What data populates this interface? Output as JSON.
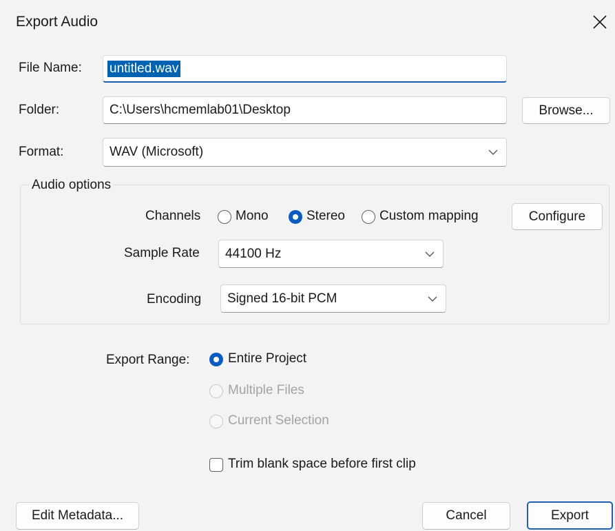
{
  "window": {
    "title": "Export Audio"
  },
  "file_name": {
    "label": "File Name:",
    "value": "untitled.wav"
  },
  "folder": {
    "label": "Folder:",
    "value": "C:\\Users\\hcmemlab01\\Desktop",
    "browse_label": "Browse..."
  },
  "format": {
    "label": "Format:",
    "selected": "WAV (Microsoft)"
  },
  "audio_options": {
    "legend": "Audio options",
    "channels": {
      "label": "Channels",
      "options": [
        {
          "label": "Mono",
          "checked": false
        },
        {
          "label": "Stereo",
          "checked": true
        },
        {
          "label": "Custom mapping",
          "checked": false
        }
      ],
      "configure_label": "Configure"
    },
    "sample_rate": {
      "label": "Sample Rate",
      "selected": "44100 Hz"
    },
    "encoding": {
      "label": "Encoding",
      "selected": "Signed 16-bit PCM"
    }
  },
  "export_range": {
    "label": "Export Range:",
    "options": [
      {
        "label": "Entire Project",
        "checked": true,
        "enabled": true
      },
      {
        "label": "Multiple Files",
        "checked": false,
        "enabled": false
      },
      {
        "label": "Current Selection",
        "checked": false,
        "enabled": false
      }
    ]
  },
  "trim": {
    "label": "Trim blank space before first clip",
    "checked": false
  },
  "footer": {
    "edit_metadata_label": "Edit Metadata...",
    "cancel_label": "Cancel",
    "export_label": "Export"
  },
  "colors": {
    "accent": "#0b5cc2",
    "background": "#f3f3f3",
    "disabled_text": "#a4a4a4"
  }
}
